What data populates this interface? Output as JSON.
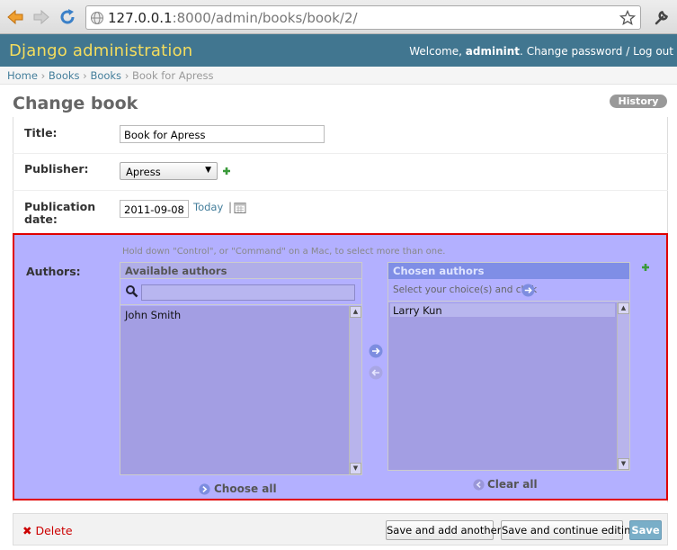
{
  "browser": {
    "url_host": "127.0.0.1",
    "url_rest": ":8000/admin/books/book/2/"
  },
  "header": {
    "branding": "Django administration",
    "welcome": "Welcome, ",
    "username": "adminint",
    "change_password": "Change password",
    "separator": " / ",
    "logout": "Log out"
  },
  "breadcrumbs": {
    "home": "Home",
    "books_app": "Books",
    "books_model": "Books",
    "current": "Book for Apress",
    "sep": " › "
  },
  "page": {
    "title": "Change book",
    "history": "History"
  },
  "form": {
    "title_label": "Title:",
    "title_value": "Book for Apress",
    "publisher_label": "Publisher:",
    "publisher_value": "Apress",
    "pubdate_label_1": "Publication",
    "pubdate_label_2": "date:",
    "pubdate_value": "2011-09-08",
    "today": "Today",
    "pipe": "|",
    "authors_label": "Authors:",
    "help_text": "Hold down \"Control\", or \"Command\" on a Mac, to select more than one.",
    "available_title": "Available authors",
    "available_options": [
      "John Smith"
    ],
    "chosen_title": "Chosen authors",
    "chosen_hint": "Select your choice(s) and click",
    "chosen_options": [
      "Larry Kun"
    ],
    "choose_all": "Choose all",
    "clear_all": "Clear all"
  },
  "submit": {
    "delete": "Delete",
    "save_add_another": "Save and add another",
    "save_continue": "Save and continue editing",
    "save": "Save"
  },
  "colors": {
    "header_bg": "#417690",
    "branding": "#f5dd5d",
    "highlight_bg": "#b3b0ff",
    "highlight_border": "#e00000"
  }
}
